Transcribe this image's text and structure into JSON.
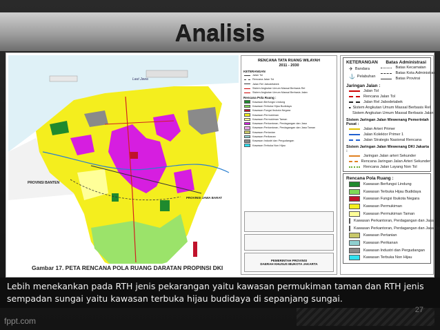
{
  "slide": {
    "title": "Analisis",
    "caption": "Gambar 17. PETA RENCANA POLA RUANG DARATAN PROPINSI DKI JAKARTA",
    "body_text": "Lebih menekankan pada RTH jenis pekarangan yaitu kawasan permukiman taman dan RTH jenis sempadan sungai yaitu kawasan terbuka hijau budidaya di sepanjang sungai.",
    "page_number": "27",
    "footer": "fppt.com"
  },
  "map": {
    "sea_label": "Laut Jawa",
    "left_label": "PROVINSI BANTEN",
    "right_label": "PROVINSI JAWA BARAT"
  },
  "sheet": {
    "title_1": "RENCANA TATA RUANG WILAYAH",
    "title_2": "2011 - 2030",
    "keterangan": "KETERANGAN",
    "rencana": "Rencana Pola Ruang :",
    "pemerintah_1": "PEMERINTAH PROVINSI",
    "pemerintah_2": "DAERAH KHUSUS IBUKOTA JAKARTA"
  },
  "legend": {
    "keterangan": "KETERANGAN",
    "batas_title": "Batas Administrasi",
    "points": [
      "Bandara",
      "Pelabuhan"
    ],
    "batas": [
      "Batas Kecamatan",
      "Batas Kota Administrasi",
      "Batas Provinsi"
    ],
    "jaringan_title": "Jaringan Jalan :",
    "jaringan": [
      "Jalan Tol",
      "Rencana Jalan Tol",
      "Jalan Rel Jabodetabek",
      "Sistem Angkutan Umum Massal Berbasis Rel",
      "Sistem Angkutan Umum Massal Berbasis Jalan"
    ],
    "sistem_title": "Sistem Jaringan Jalan Wewenang Pemerintah Pusat :",
    "sistem_pusat": [
      "Jalan Arteri Primer",
      "Jalan Kolektor Primer 1",
      "Jalan Strategis Nasional Rencana"
    ],
    "sistem_dki_title": "Sistem Jaringan Jalan Wewenang DKI Jakarta :",
    "sistem_dki": [
      "Jaringan Jalan arteri Sekunder",
      "Rencana Jaringan Jalan Arteri Sekunder",
      "Rencana Jalan Layang Non Tol"
    ],
    "pola_title": "Rencana Pola Ruang :",
    "pola": [
      {
        "label": "Kawasan Berfungsi Lindung",
        "color": "#1f8a2e"
      },
      {
        "label": "Kawasan Terbuka Hijau Budidaya",
        "color": "#7ed957"
      },
      {
        "label": "Kawasan Fungsi Ibukota Negara",
        "color": "#c0122b"
      },
      {
        "label": "Kawasan Permukiman",
        "color": "#f4ee1e"
      },
      {
        "label": "Kawasan Permukiman Taman",
        "color": "#ffff99"
      },
      {
        "label": "Kawasan Perkantoran, Perdagangan dan Jasa",
        "color": "#d61ee0"
      },
      {
        "label": "Kawasan Perkantoran, Perdagangan dan Jasa Taman",
        "color": "#f0a8f0"
      },
      {
        "label": "Kawasan Pertanian",
        "color": "#c8c86a"
      },
      {
        "label": "Kawasan Perikanan",
        "color": "#8fd0d0"
      },
      {
        "label": "Kawasan Industri dan Pergudangan",
        "color": "#8a8a8a"
      },
      {
        "label": "Kawasan Terbuka Non Hijau",
        "color": "#30e0f0"
      }
    ]
  }
}
